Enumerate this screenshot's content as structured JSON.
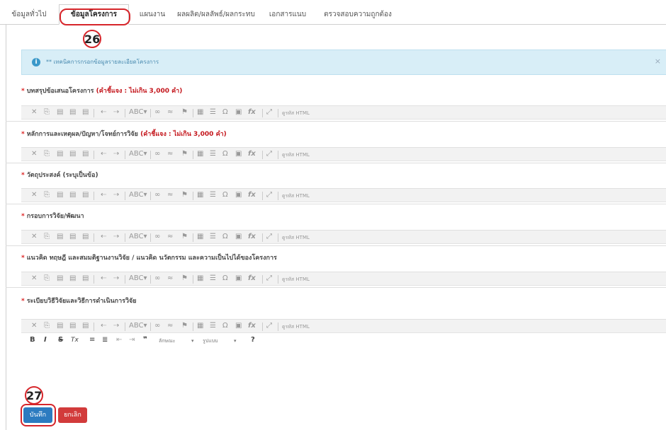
{
  "tabs": [
    {
      "label": "ข้อมูลทั่วไป"
    },
    {
      "label": "ข้อมูลโครงการ",
      "active": true
    },
    {
      "label": "แผนงาน"
    },
    {
      "label": "ผลผลิต/ผลลัพธ์/ผลกระทบ"
    },
    {
      "label": "เอกสารแนบ"
    },
    {
      "label": "ตรวจสอบความถูกต้อง"
    }
  ],
  "markers": {
    "tab_step": "26",
    "save_step": "27"
  },
  "alert": {
    "icon": "info-icon",
    "text": "** เทคนิคการกรอกข้อมูลรายละเอียดโครงการ",
    "close": "×"
  },
  "fields": [
    {
      "label": "บทสรุปข้อเสนอโครงการ",
      "hint": "(คำชี้แจง : ไม่เกิน 3,000 คำ)"
    },
    {
      "label": "หลักการและเหตุผล/ปัญหา/โจทย์การวิจัย",
      "hint": "(คำชี้แจง : ไม่เกิน 3,000 คำ)"
    },
    {
      "label": "วัตถุประสงค์ (ระบุเป็นข้อ)",
      "hint": ""
    },
    {
      "label": "กรอบการวิจัย/พัฒนา",
      "hint": ""
    },
    {
      "label": "แนวคิด ทฤษฎี และสมมติฐานงานวิจัย / แนวคิด นวัตกรรม และความเป็นไปได้ของโครงการ",
      "hint": ""
    },
    {
      "label": "ระเบียบวิธีวิจัยและวิธีการดำเนินการวิจัย",
      "hint": ""
    }
  ],
  "required_mark": "*",
  "toolbar": {
    "cut": "✕",
    "copy": "⎘",
    "paste": "▤",
    "paste_text": "▤",
    "paste_word": "▤",
    "undo": "⇠",
    "redo": "⇢",
    "spell": "ABC▾",
    "link": "∞",
    "unlink": "≈",
    "anchor": "⚑",
    "table": "▦",
    "hr": "☰",
    "special_char": "Ω",
    "image": "▣",
    "formula": "fx",
    "maximize": "⤢",
    "source_label": "ดูรหัส HTML"
  },
  "toolbar2": {
    "bold": "B",
    "italic": "I",
    "strike": "S",
    "remove_format": "Tx",
    "numbered_list": "≡",
    "bulleted_list": "≣",
    "outdent": "⇤",
    "indent": "⇥",
    "blockquote": "❞",
    "format_label": "ลักษณะ",
    "font_label": "รูปแบบ",
    "help": "?"
  },
  "buttons": {
    "save": "บันทึก",
    "cancel": "ยกเลิก"
  }
}
